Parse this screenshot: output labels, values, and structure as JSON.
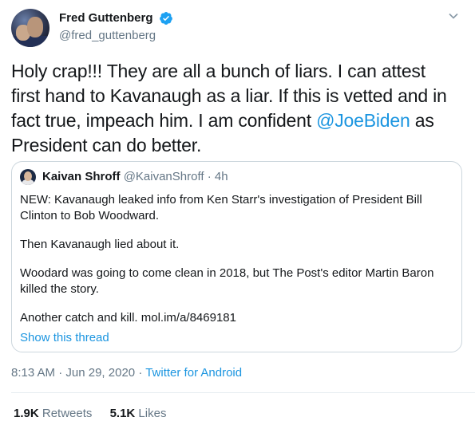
{
  "author": {
    "display_name": "Fred Guttenberg",
    "handle": "@fred_guttenberg",
    "verified_icon": "verified-badge-icon"
  },
  "tweet": {
    "text_before": "Holy crap!!!  They are all a bunch of liars.  I can attest first hand to Kavanaugh as a liar.  If this is vetted and in fact true, impeach him.  I am confident ",
    "mention": "@JoeBiden",
    "text_after": " as President can do better."
  },
  "quoted_tweet": {
    "display_name": "Kaivan Shroff",
    "handle": "@KaivanShroff",
    "separator": "·",
    "time": "4h",
    "paragraphs": [
      "NEW: Kavanaugh leaked info from Ken Starr's investigation of President Bill Clinton to Bob Woodward.",
      "Then Kavanaugh lied about it.",
      "Woodard was going to come clean in 2018, but The Post's editor Martin Baron killed the story.",
      "Another catch and kill. mol.im/a/8469181"
    ],
    "show_thread_label": "Show this thread"
  },
  "meta": {
    "time": "8:13 AM",
    "sep1": "·",
    "date": "Jun 29, 2020",
    "sep2": "·",
    "source": "Twitter for Android"
  },
  "stats": {
    "retweets_count": "1.9K",
    "retweets_label": "Retweets",
    "likes_count": "5.1K",
    "likes_label": "Likes"
  },
  "colors": {
    "link": "#1b95e0",
    "secondary_text": "#657786",
    "border": "#ccd6dd"
  }
}
